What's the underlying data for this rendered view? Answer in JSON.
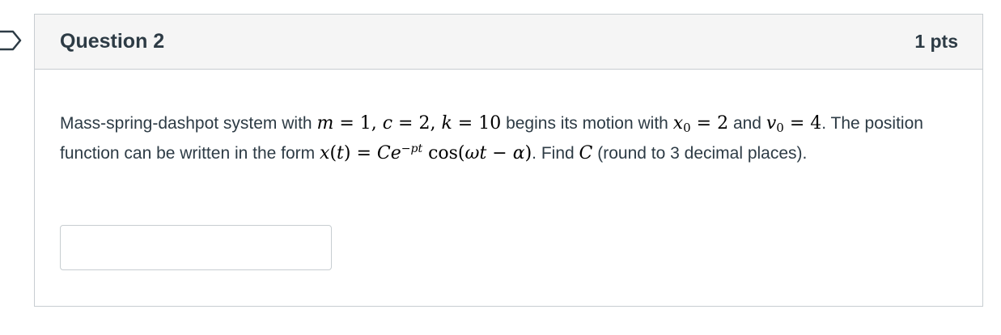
{
  "question": {
    "title": "Question 2",
    "points": "1 pts",
    "text": {
      "p1": "Mass-spring-dashpot system with",
      "m_expr": "m = 1, c = 2, k = 10",
      "p2": "begins its motion with",
      "x0_expr": "= 2",
      "p3": "and",
      "v0_expr": "= 4",
      "p4": ". The position function can be written in the form",
      "pos_expr_left": "x(t) = Ce",
      "pos_exp": "−pt",
      "pos_expr_right": "cos(ωt − α)",
      "p5": ". Find",
      "find_var": "C",
      "p6": "(round to 3 decimal places)."
    },
    "answer": {
      "value": "",
      "placeholder": ""
    }
  },
  "colors": {
    "header_bg": "#f5f5f5",
    "border": "#c7cdd1",
    "text": "#2d3b45"
  }
}
